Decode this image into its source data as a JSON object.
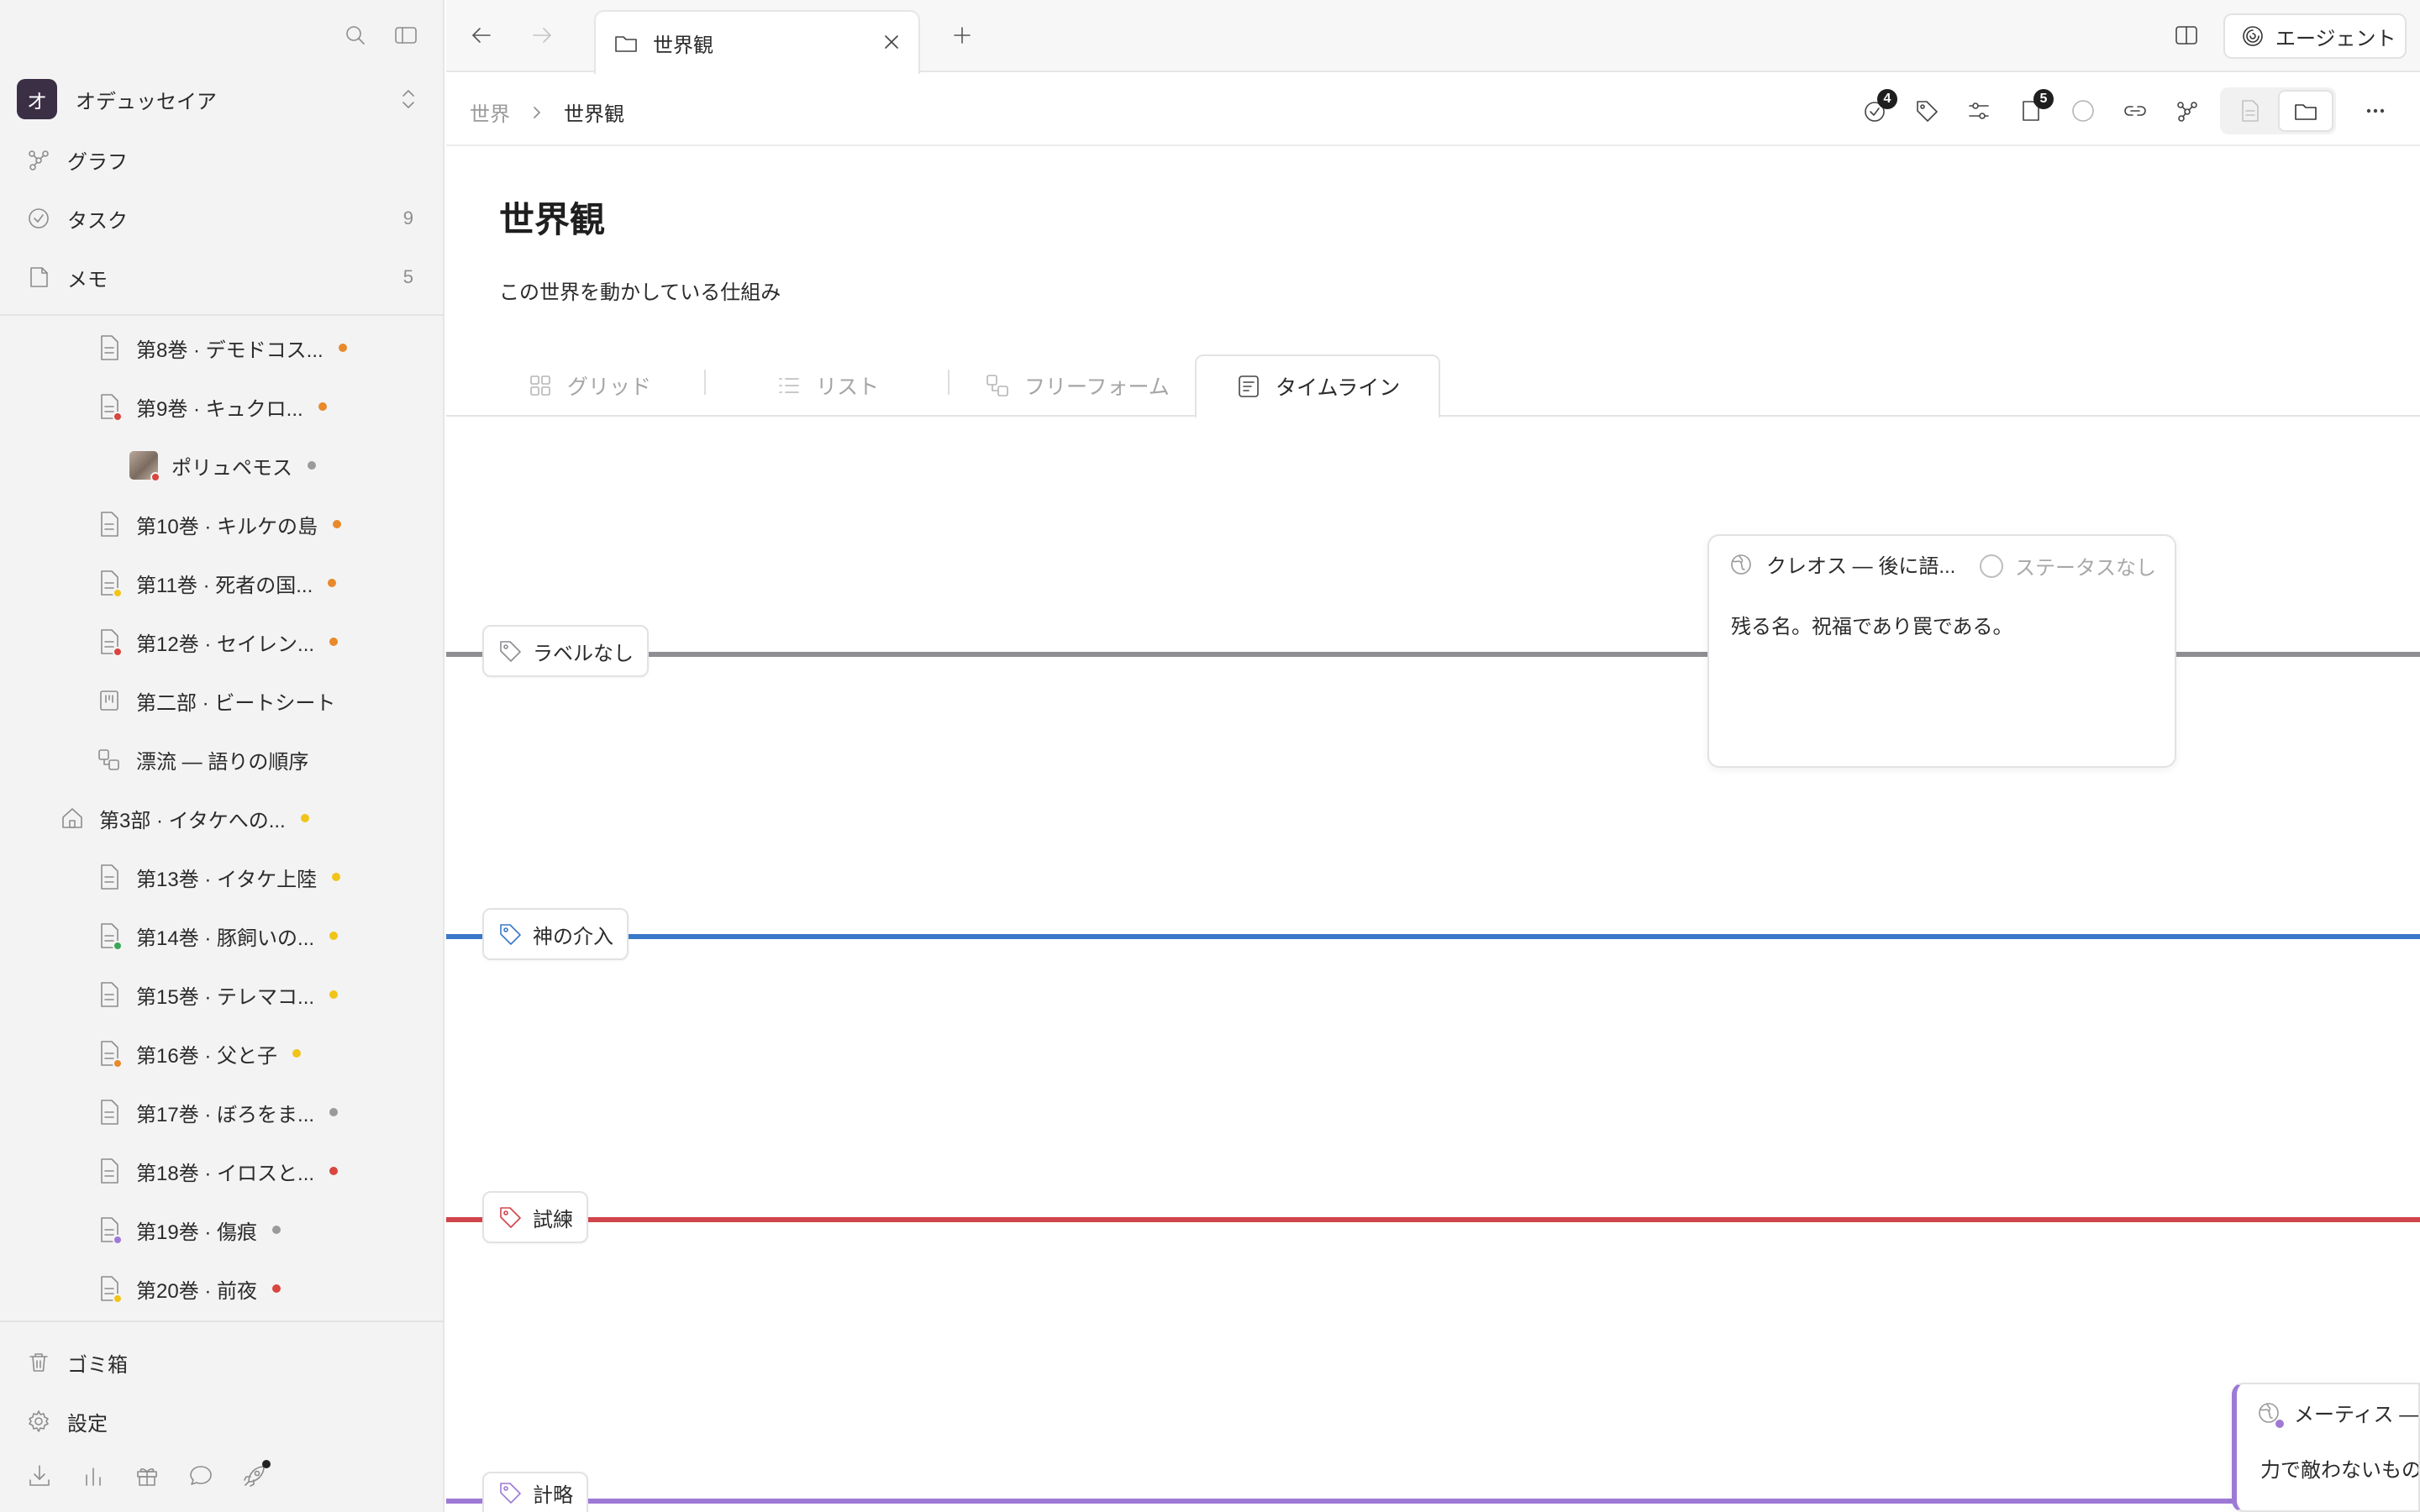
{
  "sidebar": {
    "workspace": {
      "avatar": "オ",
      "name": "オデュッセイア"
    },
    "nav": [
      {
        "label": "グラフ",
        "icon": "graph-icon",
        "count": ""
      },
      {
        "label": "タスク",
        "icon": "task-check-icon",
        "count": "9"
      },
      {
        "label": "メモ",
        "icon": "memo-icon",
        "count": "5"
      }
    ],
    "tree": [
      {
        "label": "第8巻 · デモドコス...",
        "icon": "document-icon",
        "dot": "#e8892b",
        "mini": ""
      },
      {
        "label": "第9巻 · キュクロ...",
        "icon": "document-icon",
        "dot": "#e8892b",
        "mini": "#d9453f"
      },
      {
        "label": "ポリュペモス",
        "icon": "image-thumb",
        "dot": "#9a9a9a",
        "mini": "#d9453f"
      },
      {
        "label": "第10巻 · キルケの島",
        "icon": "document-icon",
        "dot": "#e8892b",
        "mini": ""
      },
      {
        "label": "第11巻 · 死者の国...",
        "icon": "document-icon",
        "dot": "#e8892b",
        "mini": "#f0c419"
      },
      {
        "label": "第12巻 · セイレン...",
        "icon": "document-icon",
        "dot": "#e8892b",
        "mini": "#d9453f"
      },
      {
        "label": "第二部 · ビートシート",
        "icon": "board-icon",
        "dot": "",
        "mini": ""
      },
      {
        "label": "漂流 — 語りの順序",
        "icon": "freeform-icon",
        "dot": "",
        "mini": ""
      },
      {
        "label": "第3部 · イタケへの...",
        "icon": "home-icon",
        "dot": "#f0c419",
        "mini": ""
      },
      {
        "label": "第13巻 · イタケ上陸",
        "icon": "document-icon",
        "dot": "#f0c419",
        "mini": ""
      },
      {
        "label": "第14巻 · 豚飼いの...",
        "icon": "document-icon",
        "dot": "#f0c419",
        "mini": "#3aa757"
      },
      {
        "label": "第15巻 · テレマコ...",
        "icon": "document-icon",
        "dot": "#f0c419",
        "mini": ""
      },
      {
        "label": "第16巻 · 父と子",
        "icon": "document-icon",
        "dot": "#f0c419",
        "mini": "#e8892b"
      },
      {
        "label": "第17巻 · ぼろをま...",
        "icon": "document-icon",
        "dot": "#9a9a9a",
        "mini": ""
      },
      {
        "label": "第18巻 · イロスと...",
        "icon": "document-icon",
        "dot": "#d9453f",
        "mini": ""
      },
      {
        "label": "第19巻 · 傷痕",
        "icon": "document-icon",
        "dot": "#9a9a9a",
        "mini": "#9e7ad6"
      },
      {
        "label": "第20巻 · 前夜",
        "icon": "document-icon",
        "dot": "#d9453f",
        "mini": "#f0c419"
      }
    ],
    "footer": [
      {
        "label": "ゴミ箱",
        "icon": "trash-icon"
      },
      {
        "label": "設定",
        "icon": "gear-icon"
      }
    ]
  },
  "tabbar": {
    "tab_title": "世界観",
    "agent_label": "エージェント"
  },
  "header": {
    "breadcrumb_root": "世界",
    "breadcrumb_current": "世界観",
    "tasks_badge": "4",
    "pages_badge": "5"
  },
  "page": {
    "title": "世界観",
    "description": "この世界を動かしている仕組み"
  },
  "views": {
    "grid": "グリッド",
    "list": "リスト",
    "freeform": "フリーフォーム",
    "timeline": "タイムライン",
    "active": "timeline"
  },
  "timeline": {
    "lanes": [
      {
        "label": "ラベルなし",
        "color": "#8e8e93"
      },
      {
        "label": "神の介入",
        "color": "#3a78c9"
      },
      {
        "label": "試練",
        "color": "#d0444b"
      },
      {
        "label": "計略",
        "color": "#9e7ad6"
      }
    ],
    "cards": [
      {
        "title": "クレオス — 後に語...",
        "status": "ステータスなし",
        "body": "残る名。祝福であり罠である。"
      },
      {
        "title": "メーティス —",
        "body": "力で敵わないもの"
      }
    ]
  }
}
